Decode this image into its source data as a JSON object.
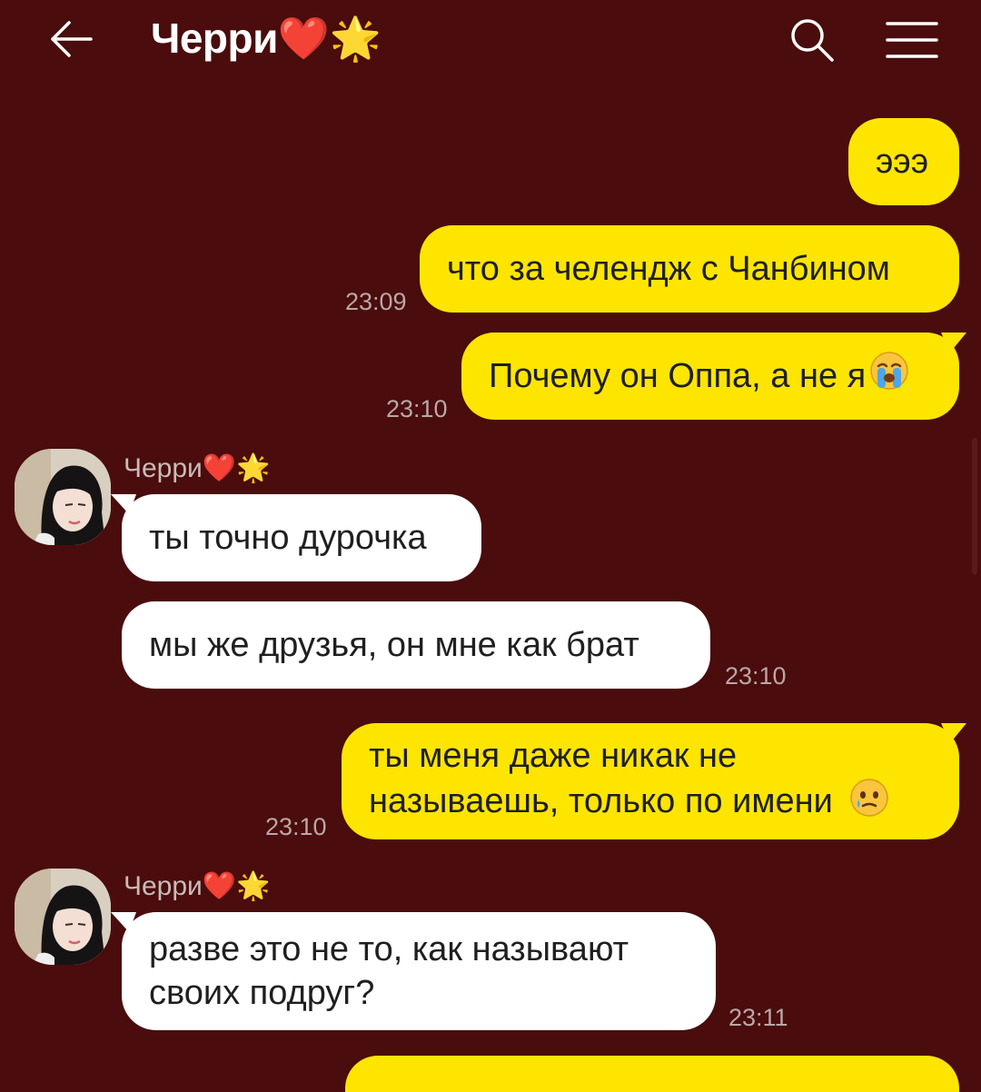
{
  "header": {
    "title": "Черри❤️🌟",
    "back_icon": "arrow-left-icon",
    "search_icon": "search-icon",
    "menu_icon": "hamburger-menu-icon"
  },
  "colors": {
    "background": "#4a0c0c",
    "outgoing_bubble": "#fee500",
    "incoming_bubble": "#ffffff",
    "timestamp": "#b9a8a6"
  },
  "messages": [
    {
      "direction": "out",
      "text": "эээ"
    },
    {
      "direction": "out",
      "text": "что за челендж с Чанбином",
      "time": "23:09"
    },
    {
      "direction": "out",
      "text": "Почему он Оппа, а не я",
      "emoji": "😭",
      "time": "23:10"
    },
    {
      "direction": "in",
      "sender": "Черри❤️🌟",
      "text": "ты точно дурочка"
    },
    {
      "direction": "in",
      "text": "мы же друзья, он мне как брат",
      "time": "23:10"
    },
    {
      "direction": "out",
      "lines": [
        "ты меня даже никак не",
        "называешь, только по имени"
      ],
      "emoji": "🥲",
      "time": "23:10"
    },
    {
      "direction": "in",
      "sender": "Черри❤️🌟",
      "lines": [
        "разве это не то, как называют",
        "своих подруг?"
      ],
      "time": "23:11"
    }
  ]
}
